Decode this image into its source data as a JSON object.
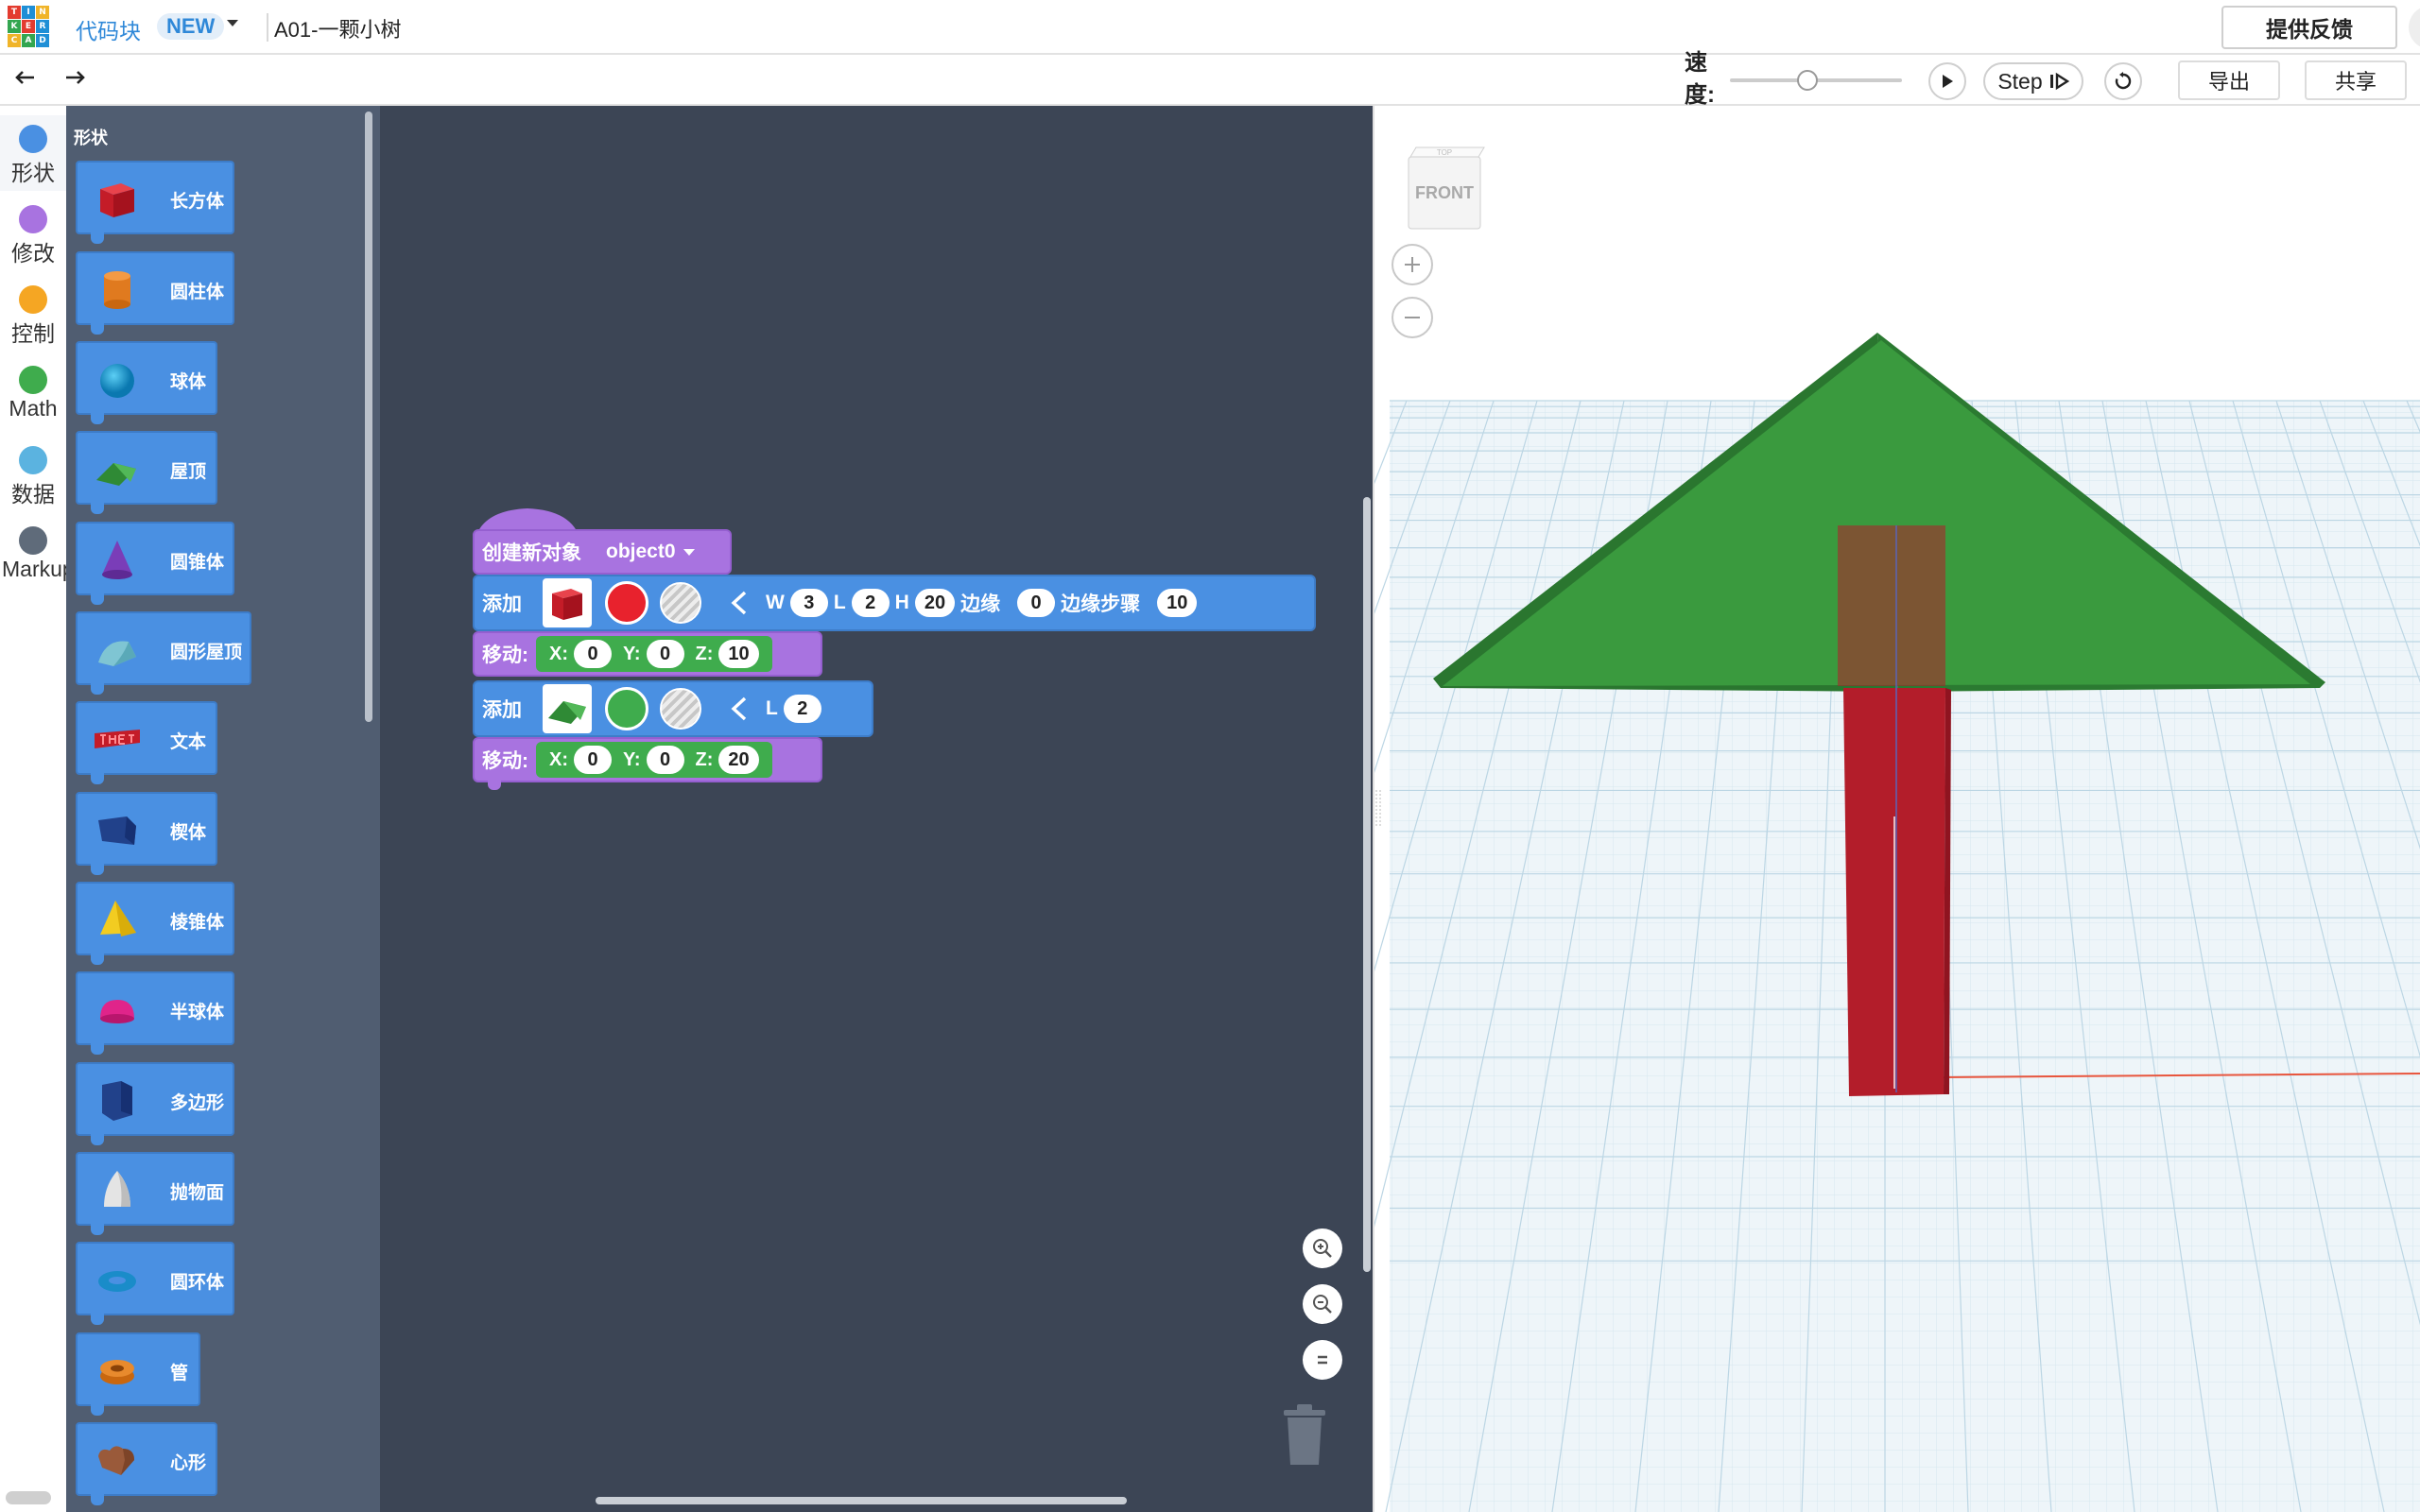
{
  "header": {
    "logo_letters": [
      "T",
      "I",
      "N",
      "K",
      "E",
      "R",
      "C",
      "A",
      "D"
    ],
    "logo_colors": [
      "#e33b2f",
      "#1f8fd6",
      "#f0b429",
      "#33a650",
      "#e33b2f",
      "#1f8fd6",
      "#f0b429",
      "#33a650",
      "#1f8fd6"
    ],
    "editor_mode": "代码块",
    "new_badge": "NEW",
    "design_title": "A01-一颗小树",
    "feedback_label": "提供反馈"
  },
  "toolbar": {
    "undo_icon": "undo-icon",
    "redo_icon": "redo-icon",
    "speed_label": "速度:",
    "speed_value": 0.45,
    "step_label": "Step",
    "export_label": "导出",
    "share_label": "共享"
  },
  "categories": [
    {
      "label": "形状",
      "color": "#4a90e2"
    },
    {
      "label": "修改",
      "color": "#a873e0"
    },
    {
      "label": "控制",
      "color": "#f5a623"
    },
    {
      "label": "Math",
      "color": "#3fac4d"
    },
    {
      "label": "数据",
      "color": "#5bb3e0"
    },
    {
      "label": "Markup",
      "color": "#5f6b7a"
    }
  ],
  "palette": {
    "title": "形状",
    "blocks": [
      {
        "label": "长方体",
        "icon": "box-icon"
      },
      {
        "label": "圆柱体",
        "icon": "cylinder-icon"
      },
      {
        "label": "球体",
        "icon": "sphere-icon"
      },
      {
        "label": "屋顶",
        "icon": "roof-icon"
      },
      {
        "label": "圆锥体",
        "icon": "cone-icon"
      },
      {
        "label": "圆形屋顶",
        "icon": "round-roof-icon"
      },
      {
        "label": "文本",
        "icon": "text-shape-icon"
      },
      {
        "label": "楔体",
        "icon": "wedge-icon"
      },
      {
        "label": "棱锥体",
        "icon": "pyramid-icon"
      },
      {
        "label": "半球体",
        "icon": "half-sphere-icon"
      },
      {
        "label": "多边形",
        "icon": "polygon-icon"
      },
      {
        "label": "抛物面",
        "icon": "paraboloid-icon"
      },
      {
        "label": "圆环体",
        "icon": "torus-icon"
      },
      {
        "label": "管",
        "icon": "tube-icon"
      },
      {
        "label": "心形",
        "icon": "heart-icon"
      }
    ]
  },
  "code": {
    "create_label": "创建新对象",
    "object_name": "object0",
    "add_label": "添加",
    "move_label": "移动:",
    "box_add": {
      "color": "#e8222d",
      "params": {
        "W": "3",
        "L": "2",
        "H": "20",
        "bevel_label": "边缘",
        "bevel": "0",
        "steps_label": "边缘步骤",
        "steps": "10"
      }
    },
    "move1": {
      "X": "0",
      "Y": "0",
      "Z": "10"
    },
    "roof_add": {
      "color": "#3fac4d",
      "params": {
        "L": "2"
      }
    },
    "move2": {
      "X": "0",
      "Y": "0",
      "Z": "20"
    }
  },
  "viewcube": {
    "face_label": "FRONT",
    "top_label": "TOP"
  },
  "scene": {
    "ground_color": "#eef5f9",
    "grid_color": "#bcd6e4",
    "roof_color": "#3a9a3e",
    "trunk_color": "#b31d2a"
  }
}
